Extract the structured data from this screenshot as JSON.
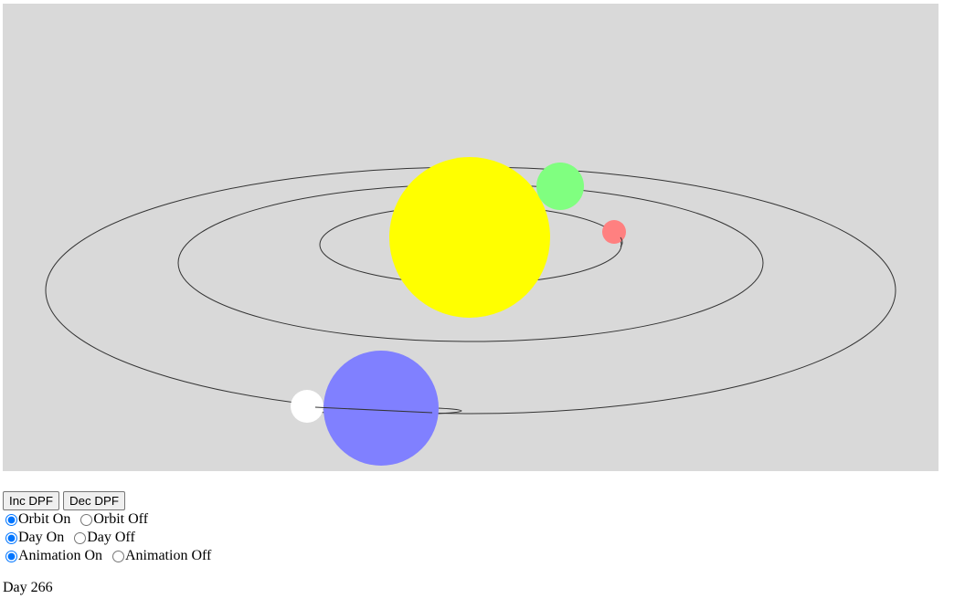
{
  "scene": {
    "background": "#d9d9d9",
    "orbit_color": "#333333",
    "bodies": [
      {
        "name": "sun",
        "color": "#ffff00"
      },
      {
        "name": "earth",
        "color": "#8080ff"
      },
      {
        "name": "moon",
        "color": "#ffffff"
      },
      {
        "name": "venus",
        "color": "#80ff80"
      },
      {
        "name": "mercury",
        "color": "#ff8080"
      }
    ]
  },
  "controls": {
    "inc_dpf_label": "Inc DPF",
    "dec_dpf_label": "Dec DPF",
    "orbit_on_label": "Orbit On",
    "orbit_off_label": "Orbit Off",
    "day_on_label": "Day On",
    "day_off_label": "Day Off",
    "animation_on_label": "Animation On",
    "animation_off_label": "Animation Off",
    "orbit_selected": "on",
    "day_selected": "on",
    "animation_selected": "on"
  },
  "status": {
    "day_text": "Day 266"
  }
}
